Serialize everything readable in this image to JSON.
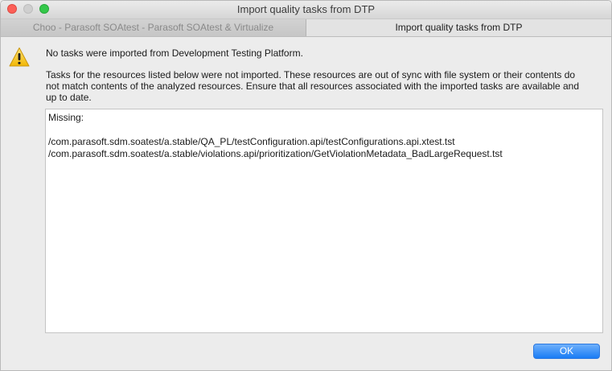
{
  "window": {
    "title": "Import quality tasks from DTP"
  },
  "tabs": [
    {
      "label": "Choo - Parasoft SOAtest - Parasoft SOAtest & Virtualize",
      "active": false
    },
    {
      "label": "Import quality tasks from DTP",
      "active": true
    }
  ],
  "dialog": {
    "icon": "warning-icon",
    "message": "No tasks were imported from Development Testing Platform.",
    "details": "Tasks for the resources listed below were not imported. These resources are out of sync with file system or their contents do not match contents of the analyzed resources. Ensure that all resources associated with the imported tasks are available and up to date.",
    "missing_label": "Missing:",
    "missing_items": [
      "/com.parasoft.sdm.soatest/a.stable/QA_PL/testConfiguration.api/testConfigurations.api.xtest.tst",
      "/com.parasoft.sdm.soatest/a.stable/violations.api/prioritization/GetViolationMetadata_BadLargeRequest.tst"
    ],
    "ok_label": "OK"
  },
  "colors": {
    "close": "#fc5f57",
    "minimize": "#cfcfcf",
    "maximize": "#34c84a",
    "accent": "#1a7cf5",
    "warning": "#f5c518"
  }
}
